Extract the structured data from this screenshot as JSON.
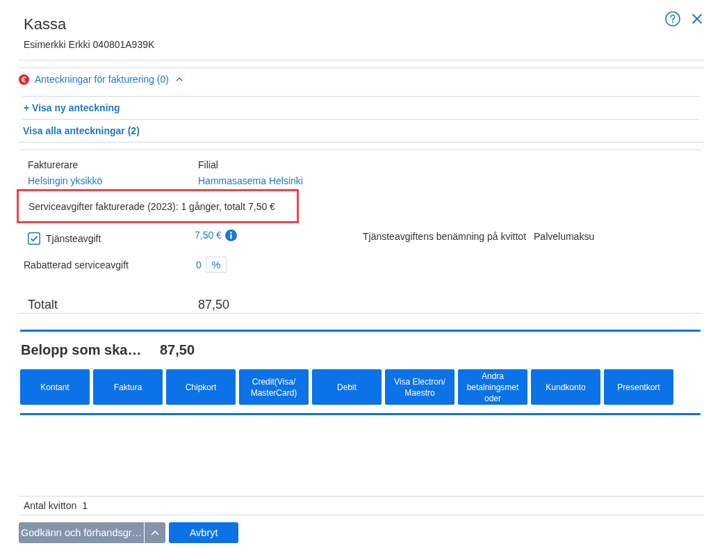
{
  "dialog": {
    "title": "Kassa",
    "subtitle": "Esimerkki Erkki 040801A939K"
  },
  "notes": {
    "label": "Anteckningar för fakturering (0)",
    "expanded": true,
    "links": [
      "+ Visa ny anteckning",
      "Visa alla anteckningar (2)"
    ]
  },
  "billing": {
    "fields": [
      {
        "label": "Fakturerare",
        "value": "Helsingin yksikkö"
      },
      {
        "label": "Filial",
        "value": "Hammasasema Helsinki"
      }
    ],
    "summary": {
      "text": "Serviceavgifter fakturerade (2023): 1 gånger, totalt 7,50 €",
      "highlighted": true
    },
    "service_fee": {
      "label": "Tjänsteavgift",
      "checked": true,
      "amount": "7,50 €",
      "receipt_label": "Tjänsteavgiftens benämning på kvittot",
      "receipt_name": "Palvelumaksu"
    },
    "discount": {
      "label": "Rabatterad serviceavgift",
      "value": "0",
      "unit": "%"
    },
    "total": {
      "label": "Totalt",
      "value": "87,50"
    }
  },
  "payment": {
    "label": "Belopp som ska…",
    "amount": "87,50",
    "methods": [
      "Kontant",
      "Faktura",
      "Chipkort",
      "Credit(Visa/ MasterCard)",
      "Debit",
      "Visa Electron/ Maestro",
      "Andra betalningsmetoder",
      "Kundkonto",
      "Presentkort"
    ]
  },
  "receipts": {
    "label": "Antal kvitton",
    "value": "1"
  },
  "footer": {
    "buttons": [
      {
        "kind": "split",
        "label": "Godkänn och förhandsgr…",
        "disabled": true
      },
      {
        "kind": "plain",
        "label": "Avbryt",
        "disabled": false
      }
    ]
  }
}
